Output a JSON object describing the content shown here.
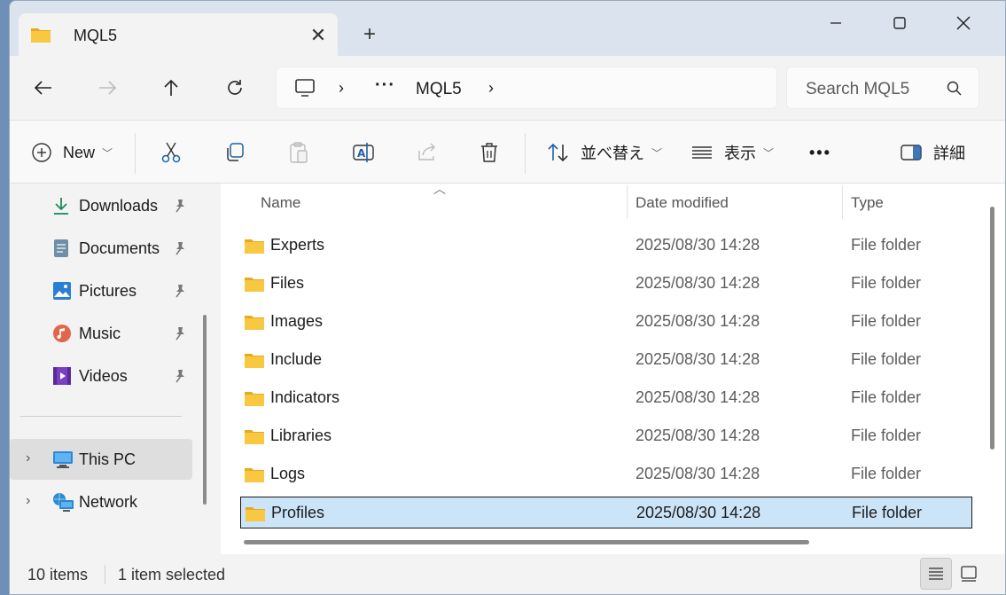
{
  "window": {
    "tab_title": "MQL5",
    "new_tab": "+"
  },
  "nav": {
    "address": {
      "more": "···",
      "current": "MQL5",
      "chevron": "›"
    },
    "search_placeholder": "Search MQL5"
  },
  "commandbar": {
    "new_label": "New",
    "sort_label": "並べ替え",
    "view_label": "表示",
    "details_label": "詳細",
    "more": "•••"
  },
  "sidebar": {
    "quick_access": [
      {
        "label": "Downloads"
      },
      {
        "label": "Documents"
      },
      {
        "label": "Pictures"
      },
      {
        "label": "Music"
      },
      {
        "label": "Videos"
      }
    ],
    "locations": [
      {
        "label": "This PC"
      },
      {
        "label": "Network"
      }
    ]
  },
  "filelist": {
    "columns": [
      "Name",
      "Date modified",
      "Type"
    ],
    "rows": [
      {
        "name": "Experts",
        "date": "2025/08/30 14:28",
        "type": "File folder"
      },
      {
        "name": "Files",
        "date": "2025/08/30 14:28",
        "type": "File folder"
      },
      {
        "name": "Images",
        "date": "2025/08/30 14:28",
        "type": "File folder"
      },
      {
        "name": "Include",
        "date": "2025/08/30 14:28",
        "type": "File folder"
      },
      {
        "name": "Indicators",
        "date": "2025/08/30 14:28",
        "type": "File folder"
      },
      {
        "name": "Libraries",
        "date": "2025/08/30 14:28",
        "type": "File folder"
      },
      {
        "name": "Logs",
        "date": "2025/08/30 14:28",
        "type": "File folder"
      },
      {
        "name": "Profiles",
        "date": "2025/08/30 14:28",
        "type": "File folder"
      }
    ],
    "selected_row": "Profiles"
  },
  "status": {
    "item_count": "10 items",
    "selection": "1 item selected"
  },
  "colors": {
    "folder": "#f8c840",
    "selection_bg": "#cce4f7",
    "accent_blue": "#0067c0"
  }
}
